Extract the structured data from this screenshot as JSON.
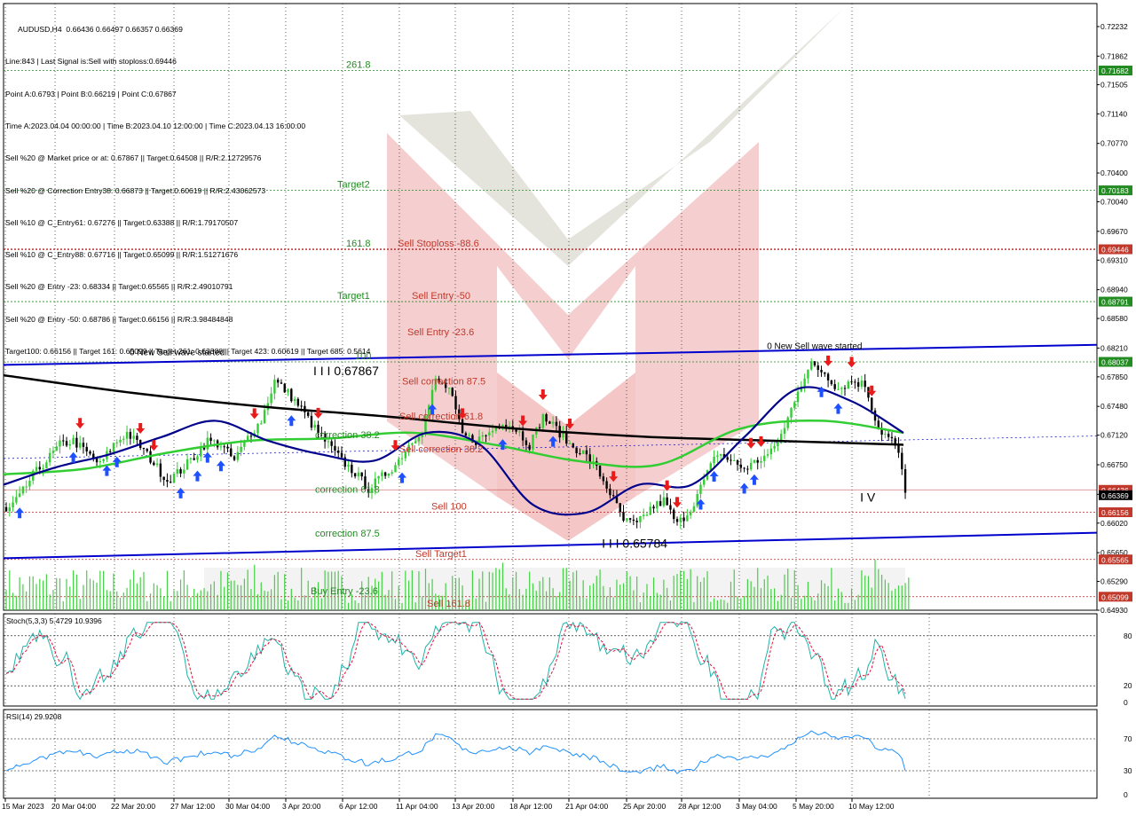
{
  "info": {
    "symbol_line": "AUDUSD,H4  0.66436 0.66497 0.66357 0.66369",
    "lines": [
      "Line:843 | Last Signal is:Sell with stoploss:0.69446",
      "Point A:0.6793 | Point B:0.66219 | Point C:0.67867",
      "Time A:2023.04.04 00:00:00 | Time B:2023.04.10 12:00:00 | Time C:2023.04.13 16:00:00",
      "Sell %20 @ Market price or at: 0.67867 || Target:0.64508 || R/R:2.12729576",
      "Sell %20 @ Correction Entry38: 0.66873 || Target:0.60619 || R/R:2.43062573",
      "Sell %10 @ C_Entry61: 0.67276 || Target:0.63388 || R/R:1.79170507",
      "Sell %10 @ C_Entry88: 0.67716 || Target:0.65099 || R/R:1.51271676",
      "Sell %20 @ Entry -23: 0.68334 || Target:0.65565 || R/R:2.49010791",
      "Sell %20 @ Entry -50: 0.68786 || Target:0.66156 || R/R:3.98484848",
      "Target100: 0.66156 || Target 161: 0.65099 || Target 261: 0.63388 || Target 423: 0.60619 || Target 685: 0.5614"
    ]
  },
  "colors": {
    "up_bar": "#32cd32",
    "down_bar": "#000000",
    "channel": "#0000cd",
    "level_green": "#228b22",
    "level_red": "#b22222",
    "ma_black": "#000000",
    "ma_green": "#32cd32",
    "ma_navy": "#00008b",
    "stoch_main": "#20b2aa",
    "stoch_signal": "#dc143c",
    "rsi": "#1e90ff"
  },
  "chart_data": [
    {
      "type": "candlestick",
      "title": "AUDUSD,H4",
      "ylim": [
        0.6493,
        0.7252
      ],
      "y_ticks": [
        "0.72232",
        "0.71862",
        "0.71505",
        "0.71140",
        "0.70770",
        "0.70400",
        "0.70040",
        "0.69670",
        "0.69310",
        "0.68940",
        "0.68580",
        "0.68210",
        "0.67850",
        "0.67480",
        "0.67120",
        "0.66750",
        "0.66380",
        "0.66020",
        "0.65650",
        "0.65290",
        "0.64930"
      ],
      "x_ticks": [
        "15 Mar 2023",
        "20 Mar 04:00",
        "22 Mar 20:00",
        "27 Mar 12:00",
        "30 Mar 04:00",
        "3 Apr 20:00",
        "6 Apr 12:00",
        "11 Apr 04:00",
        "13 Apr 20:00",
        "18 Apr 12:00",
        "21 Apr 04:00",
        "25 Apr 20:00",
        "28 Apr 12:00",
        "3 May 04:00",
        "5 May 20:00",
        "10 May 12:00"
      ],
      "anchors": [
        [
          0,
          0.6615
        ],
        [
          4,
          0.6635
        ],
        [
          8,
          0.6662
        ],
        [
          12,
          0.668
        ],
        [
          16,
          0.67
        ],
        [
          20,
          0.6705
        ],
        [
          24,
          0.669
        ],
        [
          28,
          0.6675
        ],
        [
          32,
          0.67
        ],
        [
          36,
          0.6715
        ],
        [
          40,
          0.6698
        ],
        [
          44,
          0.6677
        ],
        [
          48,
          0.6655
        ],
        [
          52,
          0.6668
        ],
        [
          56,
          0.6685
        ],
        [
          60,
          0.6705
        ],
        [
          64,
          0.67
        ],
        [
          68,
          0.668
        ],
        [
          72,
          0.671
        ],
        [
          76,
          0.673
        ],
        [
          80,
          0.678
        ],
        [
          84,
          0.6765
        ],
        [
          88,
          0.6745
        ],
        [
          92,
          0.672
        ],
        [
          96,
          0.67
        ],
        [
          100,
          0.668
        ],
        [
          104,
          0.6665
        ],
        [
          108,
          0.6645
        ],
        [
          112,
          0.666
        ],
        [
          116,
          0.6675
        ],
        [
          120,
          0.67
        ],
        [
          124,
          0.672
        ],
        [
          128,
          0.678
        ],
        [
          132,
          0.677
        ],
        [
          136,
          0.6712
        ],
        [
          140,
          0.6705
        ],
        [
          144,
          0.6715
        ],
        [
          148,
          0.673
        ],
        [
          152,
          0.672
        ],
        [
          156,
          0.67
        ],
        [
          160,
          0.6735
        ],
        [
          164,
          0.672
        ],
        [
          168,
          0.67
        ],
        [
          172,
          0.669
        ],
        [
          176,
          0.667
        ],
        [
          180,
          0.664
        ],
        [
          184,
          0.6605
        ],
        [
          188,
          0.66
        ],
        [
          192,
          0.662
        ],
        [
          196,
          0.663
        ],
        [
          200,
          0.66
        ],
        [
          204,
          0.662
        ],
        [
          208,
          0.6655
        ],
        [
          212,
          0.669
        ],
        [
          216,
          0.668
        ],
        [
          220,
          0.667
        ],
        [
          224,
          0.668
        ],
        [
          228,
          0.669
        ],
        [
          232,
          0.672
        ],
        [
          236,
          0.677
        ],
        [
          240,
          0.68
        ],
        [
          244,
          0.679
        ],
        [
          248,
          0.677
        ],
        [
          252,
          0.678
        ],
        [
          256,
          0.6775
        ],
        [
          260,
          0.672
        ],
        [
          264,
          0.6705
        ],
        [
          266,
          0.669
        ],
        [
          268,
          0.664
        ]
      ],
      "moving_averages": {
        "ma_black": [
          0.6787,
          0.6765,
          0.6748,
          0.6735,
          0.672,
          0.671,
          0.6705,
          0.67
        ],
        "ma_green": [
          0.6663,
          0.667,
          0.669,
          0.6705,
          0.6708,
          0.6715,
          0.67,
          0.668,
          0.6675,
          0.672,
          0.673,
          0.6715
        ],
        "ma_navy": [
          0.665,
          0.6672,
          0.6688,
          0.671,
          0.673,
          0.6705,
          0.6688,
          0.668,
          0.6715,
          0.67,
          0.6625,
          0.6615,
          0.665,
          0.665,
          0.671,
          0.677,
          0.6755,
          0.6715
        ]
      },
      "levels": [
        {
          "label": "261.8",
          "value": 0.71682,
          "color": "green"
        },
        {
          "label": "Target2",
          "value": 0.70183,
          "color": "green"
        },
        {
          "label": "161.8",
          "value": 0.69446,
          "color": "green"
        },
        {
          "label": "Sell Stoploss -88.6",
          "value": 0.69446,
          "color": "red"
        },
        {
          "label": "Target1",
          "value": 0.68791,
          "color": "green"
        },
        {
          "label": "Sell Entry -50",
          "value": 0.68791,
          "color": "red"
        },
        {
          "label": "Sell Entry -23.6",
          "value": 0.68334,
          "color": "red"
        },
        {
          "label": "100",
          "value": 0.68037,
          "color": "green"
        },
        {
          "label": "Sell correction 87.5",
          "value": 0.6772,
          "color": "red"
        },
        {
          "label": "Sell correction 61.8",
          "value": 0.6728,
          "color": "red"
        },
        {
          "label": "correction 38.2",
          "value": 0.6705,
          "color": "green"
        },
        {
          "label": "Sell correction 38.2",
          "value": 0.6687,
          "color": "red"
        },
        {
          "label": "correction 61.8",
          "value": 0.66369,
          "color": "green"
        },
        {
          "label": "Sell 100",
          "value": 0.66156,
          "color": "red"
        },
        {
          "label": "correction 87.5",
          "value": 0.6594,
          "color": "green"
        },
        {
          "label": "Sell Target1",
          "value": 0.65565,
          "color": "red"
        },
        {
          "label": "Buy Entry -23.6",
          "value": 0.65099,
          "color": "green"
        },
        {
          "label": "Sell 161.8",
          "value": 0.65099,
          "color": "red"
        }
      ],
      "price_tags": [
        {
          "text": "0.71682",
          "value": 0.71682,
          "color": "green"
        },
        {
          "text": "0.70183",
          "value": 0.70183,
          "color": "green"
        },
        {
          "text": "0.69446",
          "value": 0.69446,
          "color": "red"
        },
        {
          "text": "0.68791",
          "value": 0.68791,
          "color": "green"
        },
        {
          "text": "0.68037",
          "value": 0.68037,
          "color": "green"
        },
        {
          "text": "0.66436",
          "value": 0.66436,
          "color": "red"
        },
        {
          "text": "0.66369",
          "value": 0.66369,
          "color": "black"
        },
        {
          "text": "0.66156",
          "value": 0.66156,
          "color": "red"
        },
        {
          "text": "0.65565",
          "value": 0.65565,
          "color": "red"
        },
        {
          "text": "0.65099",
          "value": 0.65099,
          "color": "red"
        }
      ],
      "annotations": [
        {
          "text": "0 New Sell wave started",
          "bar": 50,
          "value": 0.6812
        },
        {
          "text": "I I I 0.67867",
          "bar": 100,
          "value": 0.6787
        },
        {
          "text": "0 New Sell wave started",
          "bar": 240,
          "value": 0.682
        },
        {
          "text": "I I I 0.65784",
          "bar": 186,
          "value": 0.6571
        },
        {
          "text": "I V",
          "bar": 263,
          "value": 0.6629
        }
      ]
    },
    {
      "type": "line",
      "title": "Stoch(5,3,3) 5.4729 10.9396",
      "ylim": [
        0,
        100
      ],
      "y_ticks": [
        "80",
        "20",
        "0"
      ],
      "levels": [
        80,
        20
      ]
    },
    {
      "type": "line",
      "title": "RSI(14) 29.9208",
      "ylim": [
        0,
        100
      ],
      "y_ticks": [
        "70",
        "30",
        "0"
      ],
      "levels": [
        70,
        30
      ]
    }
  ]
}
